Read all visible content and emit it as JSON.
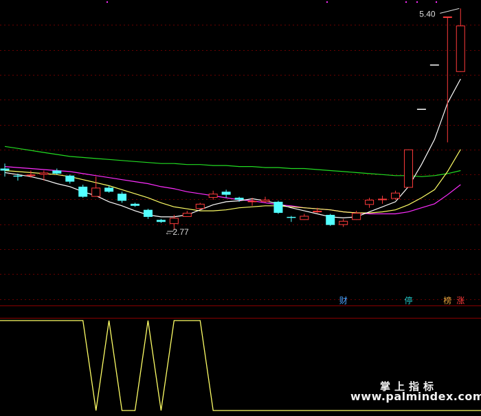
{
  "chart_data": [
    {
      "type": "candlestick",
      "panel": "main",
      "ylim": [
        2.45,
        5.45
      ],
      "colors": {
        "up": "#ff3b3b",
        "down": "#53ffff",
        "ma5": "#ffffff",
        "ma10": "#ffff66",
        "ma20": "#ff2dff",
        "ma60": "#22dd22",
        "grid": "#6a0000"
      },
      "candles": [
        [
          3.81,
          3.79,
          3.86,
          3.73
        ],
        [
          3.74,
          3.73,
          3.76,
          3.69
        ],
        [
          3.74,
          3.75,
          3.79,
          3.72
        ],
        [
          3.75,
          3.77,
          3.79,
          3.69
        ],
        [
          3.79,
          3.76,
          3.81,
          3.75
        ],
        [
          3.74,
          3.68,
          3.75,
          3.66
        ],
        [
          3.63,
          3.53,
          3.65,
          3.52
        ],
        [
          3.53,
          3.62,
          3.73,
          3.53
        ],
        [
          3.62,
          3.58,
          3.64,
          3.57
        ],
        [
          3.56,
          3.49,
          3.58,
          3.47
        ],
        [
          3.46,
          3.44,
          3.47,
          3.43
        ],
        [
          3.4,
          3.33,
          3.41,
          3.31
        ],
        [
          3.3,
          3.28,
          3.31,
          3.27
        ],
        [
          3.26,
          3.32,
          3.35,
          3.2
        ],
        [
          3.33,
          3.37,
          3.39,
          3.35
        ],
        [
          3.41,
          3.46,
          3.47,
          3.4
        ],
        [
          3.52,
          3.56,
          3.59,
          3.5
        ],
        [
          3.58,
          3.55,
          3.6,
          3.52
        ],
        [
          3.52,
          3.5,
          3.53,
          3.48
        ],
        [
          3.49,
          3.49,
          3.52,
          3.44
        ],
        [
          3.48,
          3.5,
          3.53,
          3.47
        ],
        [
          3.48,
          3.37,
          3.49,
          3.36
        ],
        [
          3.33,
          3.32,
          3.34,
          3.28
        ],
        [
          3.3,
          3.34,
          3.36,
          3.3
        ],
        [
          3.39,
          3.39,
          3.42,
          3.37
        ],
        [
          3.35,
          3.25,
          3.36,
          3.24
        ],
        [
          3.25,
          3.29,
          3.31,
          3.23
        ],
        [
          3.3,
          3.37,
          3.39,
          3.3
        ],
        [
          3.45,
          3.5,
          3.52,
          3.42
        ],
        [
          3.51,
          3.51,
          3.54,
          3.46
        ],
        [
          3.51,
          3.57,
          3.59,
          3.5
        ],
        [
          3.62,
          4.0,
          4.0,
          3.62
        ],
        [
          4.4,
          4.4,
          4.4,
          4.4
        ],
        [
          4.84,
          4.84,
          4.84,
          4.84
        ],
        [
          5.32,
          5.32,
          5.32,
          4.07
        ],
        [
          4.77,
          5.23,
          5.4,
          4.77
        ]
      ],
      "ma": {
        "ma5": [
          3.77,
          3.75,
          3.73,
          3.7,
          3.66,
          3.63,
          3.58,
          3.54,
          3.48,
          3.44,
          3.39,
          3.35,
          3.33,
          3.33,
          3.35,
          3.4,
          3.45,
          3.48,
          3.49,
          3.51,
          3.49,
          3.46,
          3.42,
          3.39,
          3.36,
          3.33,
          3.32,
          3.33,
          3.38,
          3.43,
          3.48,
          3.63,
          3.85,
          4.1,
          4.46,
          4.7
        ],
        "ma10": [
          3.79,
          3.78,
          3.77,
          3.76,
          3.75,
          3.73,
          3.7,
          3.67,
          3.64,
          3.6,
          3.56,
          3.52,
          3.47,
          3.43,
          3.41,
          3.39,
          3.39,
          3.4,
          3.42,
          3.43,
          3.44,
          3.44,
          3.43,
          3.42,
          3.41,
          3.4,
          3.38,
          3.37,
          3.37,
          3.38,
          3.4,
          3.45,
          3.52,
          3.6,
          3.78,
          4.0
        ],
        "ma20": [
          3.83,
          3.82,
          3.81,
          3.8,
          3.79,
          3.78,
          3.76,
          3.74,
          3.72,
          3.7,
          3.68,
          3.66,
          3.63,
          3.61,
          3.58,
          3.56,
          3.54,
          3.52,
          3.5,
          3.49,
          3.47,
          3.45,
          3.44,
          3.42,
          3.41,
          3.4,
          3.38,
          3.37,
          3.36,
          3.36,
          3.36,
          3.38,
          3.42,
          3.46,
          3.55,
          3.65
        ],
        "ma60": [
          4.03,
          4.01,
          3.99,
          3.97,
          3.95,
          3.93,
          3.92,
          3.91,
          3.9,
          3.89,
          3.88,
          3.87,
          3.86,
          3.86,
          3.85,
          3.85,
          3.84,
          3.84,
          3.83,
          3.83,
          3.82,
          3.82,
          3.81,
          3.81,
          3.8,
          3.79,
          3.78,
          3.77,
          3.76,
          3.75,
          3.74,
          3.74,
          3.73,
          3.74,
          3.76,
          3.79
        ]
      },
      "annotations": {
        "max_label": "5.40",
        "min_label": "2.77"
      },
      "markers": [
        {
          "index": 26,
          "label": "财",
          "color": "#4aa3ff"
        },
        {
          "index": 31,
          "label": "停",
          "color": "#22cccc"
        },
        {
          "index": 34,
          "label": "榜",
          "color": "#e6a23c"
        },
        {
          "index": 35,
          "label": "涨",
          "color": "#ff3b3b"
        }
      ]
    },
    {
      "type": "line",
      "panel": "indicator",
      "ylim": [
        0,
        1
      ],
      "color": "#ffff66",
      "values": [
        1,
        1,
        1,
        1,
        1,
        1,
        1,
        0,
        1,
        0,
        0,
        1,
        0,
        1,
        1,
        1,
        0,
        0,
        0,
        0,
        0,
        0,
        0,
        0,
        0,
        0,
        0,
        0,
        0,
        0,
        0,
        0,
        0,
        0,
        0,
        0
      ]
    }
  ],
  "watermark": {
    "line1": "掌上指标",
    "line2": "www.palmindex.com"
  }
}
